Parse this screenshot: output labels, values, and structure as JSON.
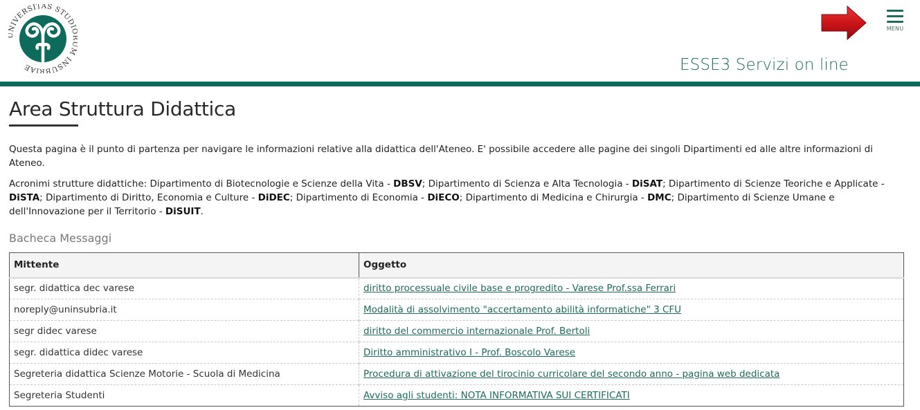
{
  "header": {
    "logo_text": "UNIVERSITAS STUDIORUM INSUBRIAE",
    "menu_label": "MENU",
    "service_title": "ESSE3 Servizi on line"
  },
  "page": {
    "title": "Area Struttura Didattica",
    "intro": "Questa pagina è il punto di partenza per navigare le informazioni relative alla didattica dell'Ateneo. E' possibile accedere alle pagine dei singoli Dipartimenti ed alle altre informazioni di Ateneo.",
    "acronyms": [
      {
        "text": "Acronimi strutture didattiche: Dipartimento di Biotecnologie e Scienze della Vita - ",
        "bold": "DBSV"
      },
      {
        "text": "; Dipartimento di Scienza e Alta Tecnologia - ",
        "bold": "DiSAT"
      },
      {
        "text": "; Dipartimento di Scienze Teoriche e Applicate - ",
        "bold": "DiSTA"
      },
      {
        "text": "; Dipartimento di Diritto, Economia e Culture - ",
        "bold": "DiDEC"
      },
      {
        "text": "; Dipartimento di Economia - ",
        "bold": "DiECO"
      },
      {
        "text": "; Dipartimento di Medicina e Chirurgia - ",
        "bold": "DMC"
      },
      {
        "text": "; Dipartimento di Scienze Umane e dell'Innovazione per il Territorio - ",
        "bold": "DiSUIT"
      }
    ],
    "acronyms_end": ".",
    "section_title": "Bacheca Messaggi"
  },
  "table": {
    "headers": [
      "Mittente",
      "Oggetto"
    ],
    "rows": [
      {
        "mittente": "segr. didattica dec varese",
        "oggetto": "diritto processuale civile base e progredito - Varese Prof.ssa Ferrari"
      },
      {
        "mittente": "noreply@uninsubria.it",
        "oggetto": "Modalità di assolvimento \"accertamento abilità informatiche\" 3 CFU"
      },
      {
        "mittente": "segr didec varese",
        "oggetto": "diritto del commercio internazionale Prof. Bertoli"
      },
      {
        "mittente": "segr. didattica didec varese",
        "oggetto": "Diritto amministrativo I - Prof. Boscolo Varese"
      },
      {
        "mittente": "Segreteria didattica Scienze Motorie - Scuola di Medicina",
        "oggetto": "Procedura di attivazione del tirocinio curricolare del secondo anno - pagina web dedicata"
      },
      {
        "mittente": "Segreteria Studenti",
        "oggetto": "Avviso agli studenti: NOTA INFORMATIVA SUI CERTIFICATI"
      }
    ]
  },
  "colors": {
    "brand_green": "#0e6b5b",
    "link": "#1e6b5c",
    "arrow_red": "#c8141a"
  },
  "icons": {
    "logo": "university-seal-icon",
    "arrow": "red-arrow-icon",
    "menu": "hamburger-menu-icon"
  }
}
